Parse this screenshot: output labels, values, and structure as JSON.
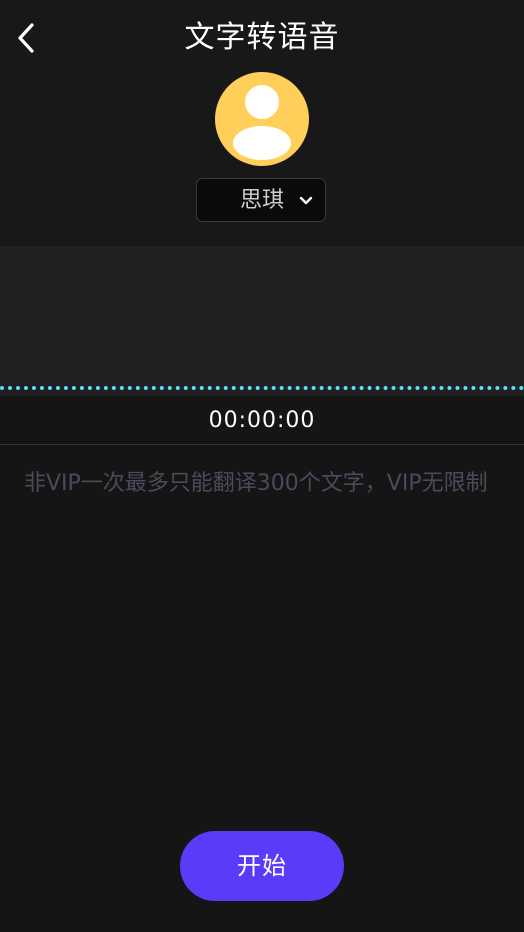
{
  "header": {
    "title": "文字转语音",
    "back_icon": "chevron-left-icon"
  },
  "avatar": {
    "icon": "user-silhouette-icon",
    "background_color": "#FFCF5A"
  },
  "voice_selector": {
    "selected": "思琪",
    "icon": "chevron-down-icon"
  },
  "waveform": {
    "color": "#5DDCF5"
  },
  "timer": {
    "value": "00:00:00"
  },
  "text_input": {
    "value": "",
    "placeholder": "非VIP一次最多只能翻译300个文字，VIP无限制"
  },
  "start_button": {
    "label": "开始",
    "color": "#5B3BFA"
  }
}
